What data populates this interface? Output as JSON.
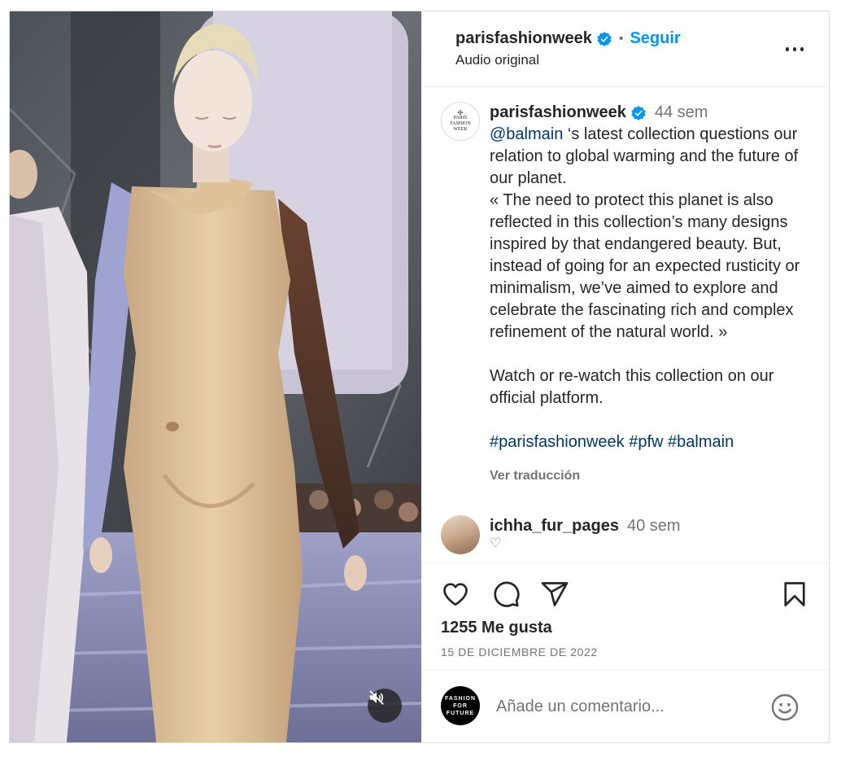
{
  "post": {
    "author": "parisfashionweek",
    "follow_label": "Seguir",
    "separator": "•",
    "audio": "Audio original"
  },
  "caption": {
    "author": "parisfashionweek",
    "time": "44 sem",
    "mention": "@balmain",
    "line1_rest": " ‘s latest collection questions our relation to global warming and the future of our planet.",
    "quote": "« The need to protect this planet is also reflected in this collection’s many designs inspired by that endangered beauty. But, instead of going for an expected rusticity or minimalism, we’ve aimed to explore and celebrate the fascinating rich and complex refinement of the natural world. »",
    "watch": "Watch or re-watch this collection on our official platform.",
    "hashtags": [
      "#parisfashionweek",
      "#pfw",
      "#balmain"
    ],
    "translate": "Ver traducción",
    "avatar_text": [
      "PARIS",
      "FASHION",
      "WEEK"
    ]
  },
  "comment": {
    "author": "ichha_fur_pages",
    "time": "40 sem"
  },
  "actions": {
    "likes": "1255 Me gusta",
    "date": "15 DE DICIEMBRE DE 2022"
  },
  "composer": {
    "placeholder": "Añade un comentario...",
    "avatar_text": [
      "FASHION",
      "FOR",
      "FUTURE"
    ]
  },
  "icons": {
    "verified": "verified-badge-icon",
    "like": "heart-icon",
    "comment": "speech-bubble-icon",
    "share": "paper-plane-icon",
    "save": "bookmark-icon",
    "more": "more-options-icon",
    "mute": "speaker-muted-icon",
    "emoji": "smiley-icon"
  },
  "colors": {
    "link_blue": "#0095f6",
    "hashtag": "#00376b",
    "verified": "#0095f6",
    "muted_text": "#737373"
  }
}
